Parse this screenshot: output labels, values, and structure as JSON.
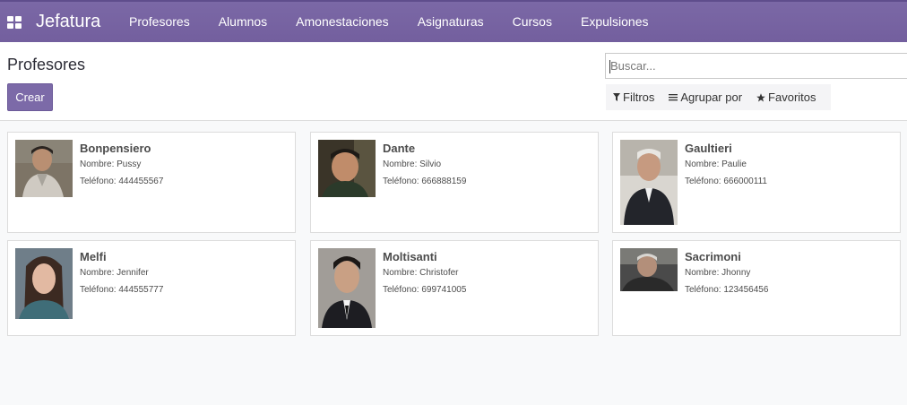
{
  "app": {
    "brand": "Jefatura",
    "apps_icon": "grid-icon"
  },
  "menu": [
    {
      "label": "Profesores"
    },
    {
      "label": "Alumnos"
    },
    {
      "label": "Amonestaciones"
    },
    {
      "label": "Asignaturas"
    },
    {
      "label": "Cursos"
    },
    {
      "label": "Expulsiones"
    }
  ],
  "control": {
    "title": "Profesores",
    "create_label": "Crear",
    "search_placeholder": "Buscar...",
    "filters_label": "Filtros",
    "group_label": "Agrupar por",
    "favorites_label": "Favoritos"
  },
  "fields": {
    "name_prefix": "Nombre:",
    "phone_prefix": "Teléfono:"
  },
  "cards": [
    {
      "surname": "Bonpensiero",
      "name": "Pussy",
      "phone": "444455567"
    },
    {
      "surname": "Dante",
      "name": "Silvio",
      "phone": "666888159"
    },
    {
      "surname": "Gaultieri",
      "name": "Paulie",
      "phone": "666000111"
    },
    {
      "surname": "Melfi",
      "name": "Jennifer",
      "phone": "444555777"
    },
    {
      "surname": "Moltisanti",
      "name": "Christofer",
      "phone": "699741005"
    },
    {
      "surname": "Sacrimoni",
      "name": "Jhonny",
      "phone": "123456456"
    }
  ],
  "colors": {
    "brand": "#7c6aa8",
    "background": "#f8f9fa"
  }
}
